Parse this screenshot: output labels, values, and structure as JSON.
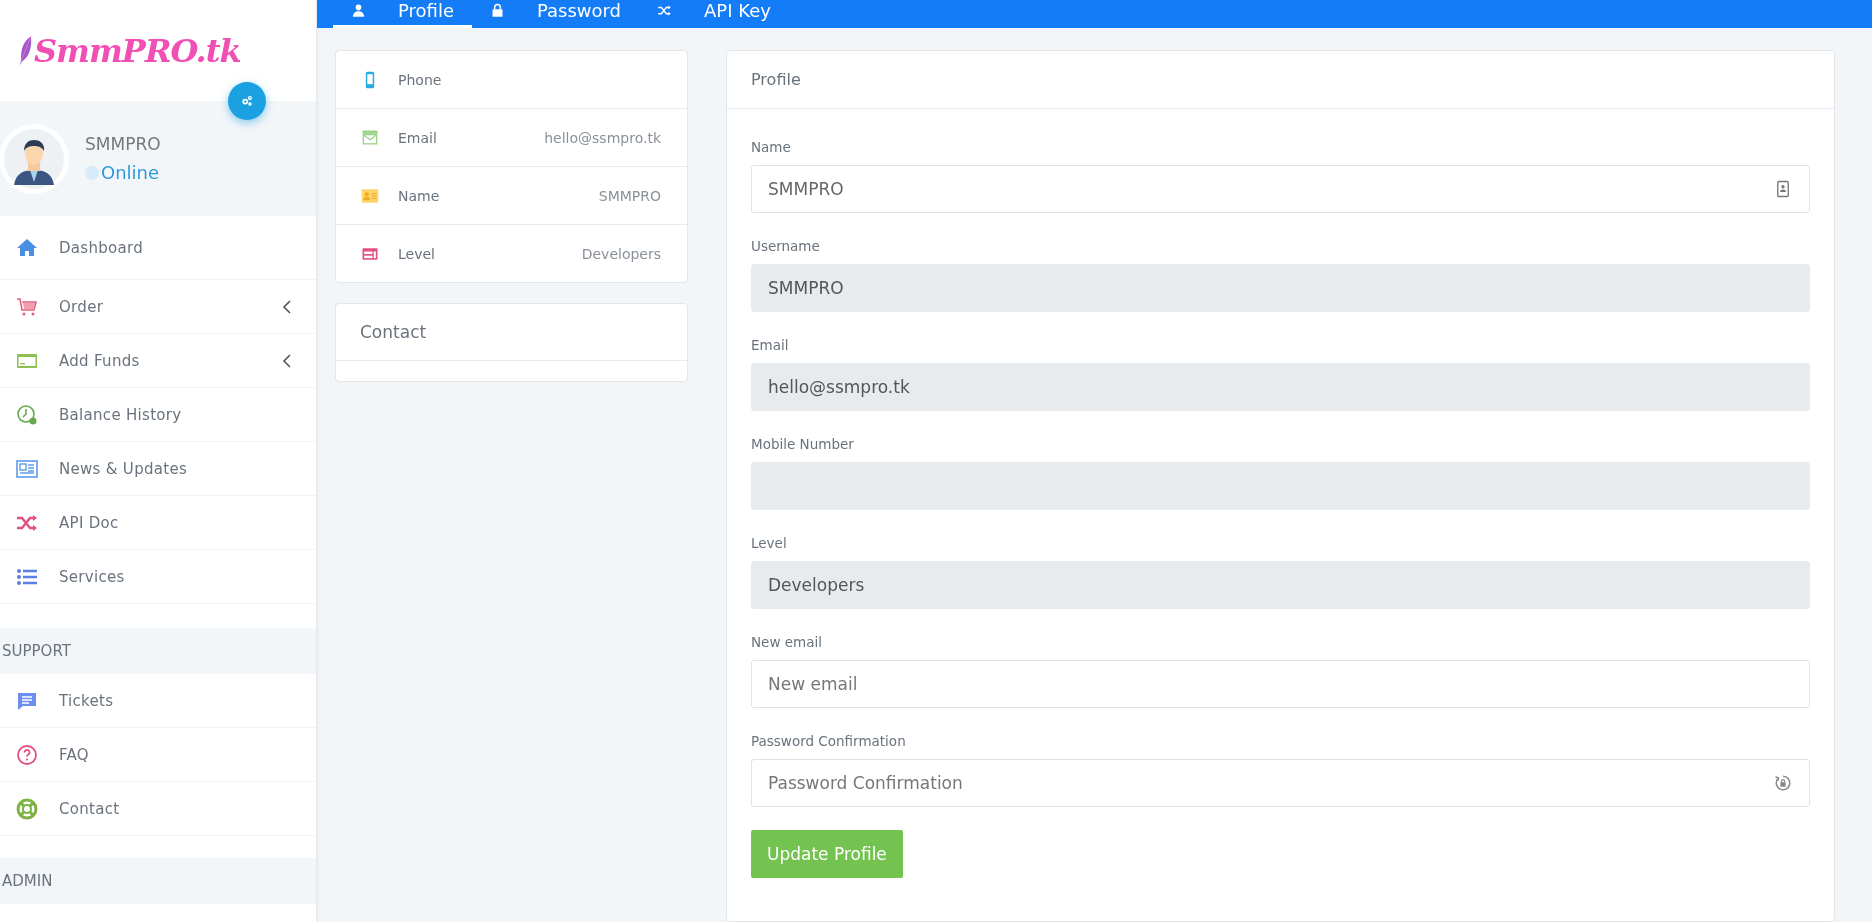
{
  "sidebar": {
    "logo": "SmmPRO.tk",
    "user": {
      "name": "SMMPRO",
      "status": "Online"
    },
    "sections": [
      {
        "items": [
          {
            "label": "Dashboard",
            "kind": "home",
            "expandable": false
          },
          {
            "label": "Order",
            "kind": "cart",
            "expandable": true
          },
          {
            "label": "Add Funds",
            "kind": "card",
            "expandable": true
          },
          {
            "label": "Balance History",
            "kind": "clock",
            "expandable": false
          },
          {
            "label": "News & Updates",
            "kind": "news",
            "expandable": false
          },
          {
            "label": "API Doc",
            "kind": "shuffle",
            "expandable": false
          },
          {
            "label": "Services",
            "kind": "list",
            "expandable": false
          }
        ]
      },
      {
        "heading": "SUPPORT",
        "items": [
          {
            "label": "Tickets",
            "kind": "chat",
            "expandable": false
          },
          {
            "label": "FAQ",
            "kind": "question",
            "expandable": false
          },
          {
            "label": "Contact",
            "kind": "lifebuoy",
            "expandable": false
          }
        ]
      },
      {
        "heading": "ADMIN"
      }
    ]
  },
  "tabs": [
    {
      "label": "Profile",
      "kind": "user",
      "selected": true
    },
    {
      "label": "Password",
      "kind": "lock",
      "selected": false
    },
    {
      "label": "API Key",
      "kind": "shuffle",
      "selected": false
    }
  ],
  "info_card": {
    "rows": [
      {
        "label": "Phone",
        "kind": "phone"
      },
      {
        "label": "Email",
        "kind": "mail",
        "value": "hello@ssmpro.tk"
      },
      {
        "label": "Name",
        "kind": "idcard",
        "value": "SMMPRO"
      },
      {
        "label": "Level",
        "kind": "level",
        "value": "Developers"
      }
    ]
  },
  "contact_card": {
    "title": "Contact"
  },
  "profile_form": {
    "title": "Profile",
    "fields": [
      {
        "label": "Name",
        "value": "SMMPRO",
        "disabled": false,
        "kind": "contact"
      },
      {
        "label": "Username",
        "value": "SMMPRO",
        "disabled": true
      },
      {
        "label": "Email",
        "value": "hello@ssmpro.tk",
        "disabled": true
      },
      {
        "label": "Mobile Number",
        "disabled": true
      },
      {
        "label": "Level",
        "value": "Developers",
        "disabled": true
      },
      {
        "label": "New email",
        "placeholder": "New email",
        "disabled": false
      },
      {
        "label": "Password Confirmation",
        "placeholder": "Password Confirmation",
        "disabled": false,
        "kind": "lockcycle"
      }
    ],
    "submit": "Update Profile"
  }
}
